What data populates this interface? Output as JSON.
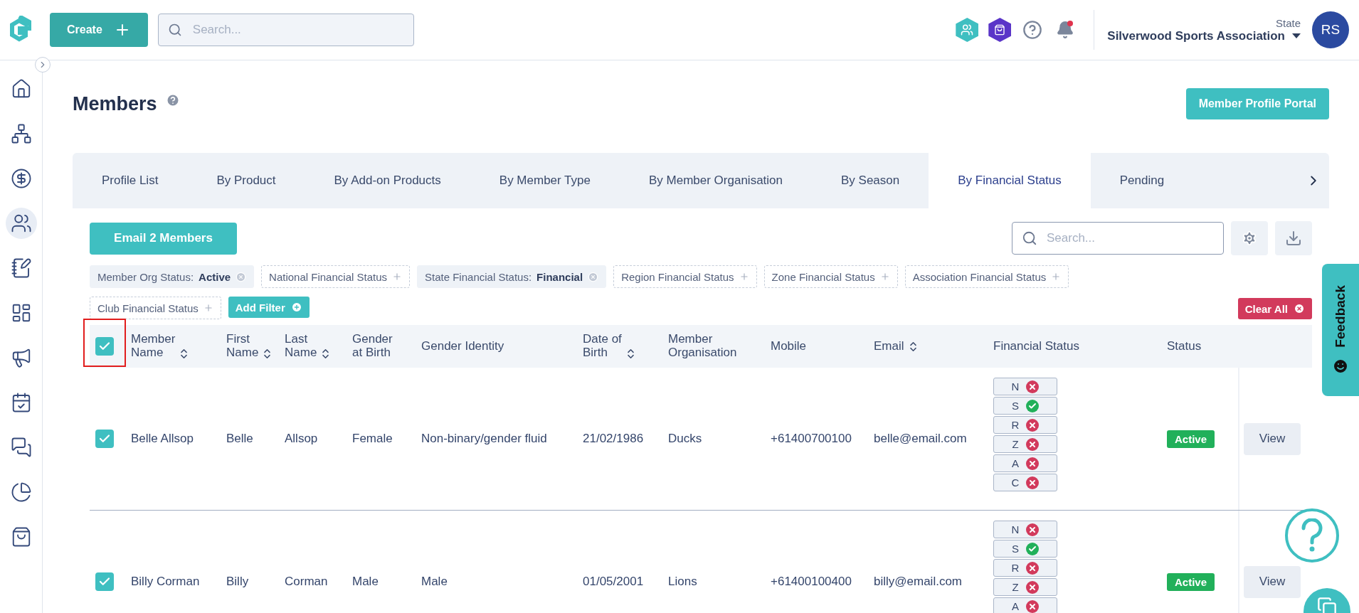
{
  "topbar": {
    "create_button": "Create",
    "search": {
      "placeholder": "Search..."
    },
    "notification_unread": true,
    "org_label": "State",
    "org_name": "Silverwood Sports Association",
    "avatar": "RS"
  },
  "sidebar": {
    "items": [
      {
        "kind": "home",
        "selected": false
      },
      {
        "kind": "hierarchy",
        "selected": false
      },
      {
        "kind": "dollar",
        "selected": false
      },
      {
        "kind": "people",
        "selected": true
      },
      {
        "kind": "form",
        "selected": false
      },
      {
        "kind": "widgets",
        "selected": false
      },
      {
        "kind": "megaphone",
        "selected": false
      },
      {
        "kind": "calendar",
        "selected": false
      },
      {
        "kind": "chat",
        "selected": false
      },
      {
        "kind": "pie",
        "selected": false
      },
      {
        "kind": "bag",
        "selected": false
      }
    ]
  },
  "page": {
    "title": "Members",
    "portal_button": "Member Profile Portal"
  },
  "tabs": [
    {
      "label": "Profile List",
      "selected": false
    },
    {
      "label": "By Product",
      "selected": false
    },
    {
      "label": "By Add-on Products",
      "selected": false
    },
    {
      "label": "By Member Type",
      "selected": false
    },
    {
      "label": "By Member Organisation",
      "selected": false
    },
    {
      "label": "By Season",
      "selected": false
    },
    {
      "label": "By Financial Status",
      "selected": true
    },
    {
      "label": "Pending",
      "selected": false
    }
  ],
  "toolbar": {
    "email_button": "Email 2 Members",
    "search": {
      "placeholder": "Search..."
    }
  },
  "filters": [
    {
      "kind": "applied",
      "label": "Member Org Status:",
      "value": "Active"
    },
    {
      "kind": "available",
      "label": "National Financial Status"
    },
    {
      "kind": "applied",
      "label": "State Financial Status:",
      "value": "Financial"
    },
    {
      "kind": "available",
      "label": "Region Financial Status"
    },
    {
      "kind": "available",
      "label": "Zone Financial Status"
    },
    {
      "kind": "available",
      "label": "Association Financial Status"
    },
    {
      "kind": "available",
      "label": "Club Financial Status"
    }
  ],
  "add_filter": "Add Filter",
  "clear_all": "Clear All",
  "table": {
    "header_checked": true,
    "columns": [
      {
        "lines": [
          "Member",
          "Name"
        ],
        "sortable": true
      },
      {
        "lines": [
          "First",
          "Name"
        ],
        "sortable": true
      },
      {
        "lines": [
          "Last",
          "Name"
        ],
        "sortable": true
      },
      {
        "lines": [
          "Gender",
          "at Birth"
        ],
        "sortable": false
      },
      {
        "lines": [
          "Gender Identity"
        ],
        "sortable": false
      },
      {
        "lines": [
          "Date of",
          "Birth"
        ],
        "sortable": true
      },
      {
        "lines": [
          "Member",
          "Organisation"
        ],
        "sortable": false
      },
      {
        "lines": [
          "Mobile"
        ],
        "sortable": false
      },
      {
        "lines": [
          "Email"
        ],
        "sortable": true
      },
      {
        "lines": [
          "Financial Status"
        ],
        "sortable": false
      },
      {
        "lines": [
          "Status"
        ],
        "sortable": false
      }
    ],
    "rows": [
      {
        "checked": true,
        "cells": [
          "Belle Allsop",
          "Belle",
          "Allsop",
          "Female",
          "Non-binary/gender fluid",
          "21/02/1986",
          "Ducks",
          "+61400700100",
          "belle@email.com"
        ],
        "financial": [
          {
            "letter": "N",
            "ok": false
          },
          {
            "letter": "S",
            "ok": true
          },
          {
            "letter": "R",
            "ok": false
          },
          {
            "letter": "Z",
            "ok": false
          },
          {
            "letter": "A",
            "ok": false
          },
          {
            "letter": "C",
            "ok": false
          }
        ],
        "status": "Active",
        "action": "View"
      },
      {
        "checked": true,
        "cells": [
          "Billy Corman",
          "Billy",
          "Corman",
          "Male",
          "Male",
          "01/05/2001",
          "Lions",
          "+61400100400",
          "billy@email.com"
        ],
        "financial": [
          {
            "letter": "N",
            "ok": false
          },
          {
            "letter": "S",
            "ok": true
          },
          {
            "letter": "R",
            "ok": false
          },
          {
            "letter": "Z",
            "ok": false
          },
          {
            "letter": "A",
            "ok": false
          }
        ],
        "status": "Active",
        "action": "View"
      }
    ]
  },
  "feedback": "Feedback"
}
